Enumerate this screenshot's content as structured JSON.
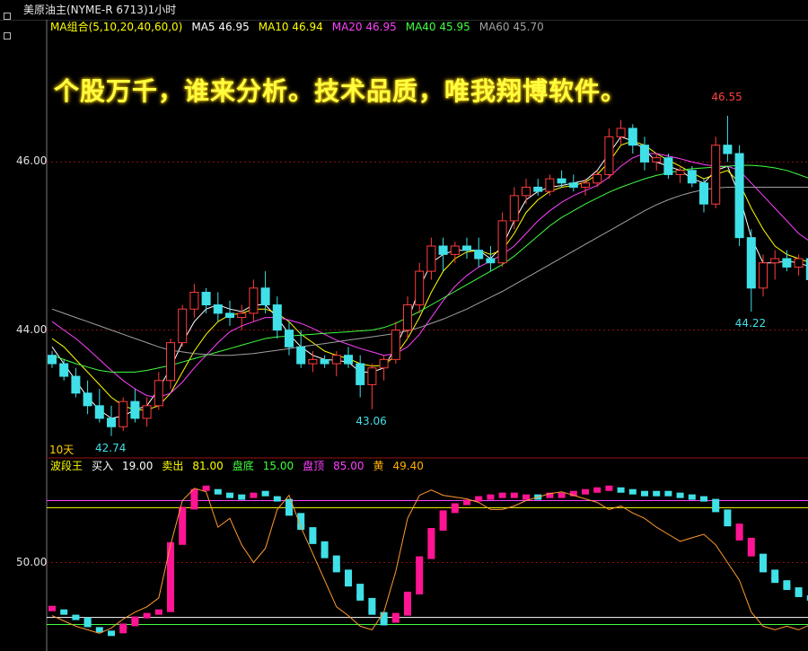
{
  "window": {
    "title": "美原油主(NYME-R 6713)1小时"
  },
  "slogan": "个股万千，谁来分析。技术品质，唯我翔博软件。",
  "period_label": "10天",
  "colors": {
    "up": "#ff3c3c",
    "down": "#40e0e8",
    "ma5": "#ffffff",
    "ma10": "#ffff00",
    "ma20": "#ff40ff",
    "ma40": "#40ff40",
    "ma60": "#a0a0a0",
    "osc_up": "#ff1493",
    "osc_down": "#40e0e8",
    "osc_line": "#ff9a30"
  },
  "ma_legend": [
    {
      "text": "MA组合(5,10,20,40,60,0)",
      "color": "#ffff00"
    },
    {
      "text": "MA5 46.95",
      "color": "#ffffff"
    },
    {
      "text": "MA10 46.94",
      "color": "#ffff00"
    },
    {
      "text": "MA20 46.95",
      "color": "#ff40ff"
    },
    {
      "text": "MA40 45.95",
      "color": "#40ff40"
    },
    {
      "text": "MA60 45.70",
      "color": "#a0a0a0"
    }
  ],
  "osc_legend": [
    {
      "text": "波段王",
      "color": "#ffff00"
    },
    {
      "text": "买入",
      "color": "#ffffff"
    },
    {
      "text": "19.00",
      "color": "#ffffff"
    },
    {
      "text": "卖出",
      "color": "#ffff00"
    },
    {
      "text": "81.00",
      "color": "#ffff00"
    },
    {
      "text": "盘底",
      "color": "#40ff40"
    },
    {
      "text": "15.00",
      "color": "#40ff40"
    },
    {
      "text": "盘顶",
      "color": "#ff40ff"
    },
    {
      "text": "85.00",
      "color": "#ff40ff"
    },
    {
      "text": "黄",
      "color": "#ffb000"
    },
    {
      "text": "49.40",
      "color": "#ffb000"
    }
  ],
  "annotations": [
    {
      "text": "46.55",
      "color": "#ff4040",
      "price": 46.55
    },
    {
      "text": "43.06",
      "color": "#40e0e8",
      "price": 43.06
    },
    {
      "text": "42.74",
      "color": "#40e0e8",
      "price": 42.74
    },
    {
      "text": "44.22",
      "color": "#40e0e8",
      "price": 44.22
    }
  ],
  "chart_data": [
    {
      "type": "candlestick",
      "ylabels": [
        "46.00",
        "44.00"
      ],
      "yticks": [
        46.0,
        44.0
      ],
      "ylim": [
        42.5,
        47.5
      ],
      "series": [
        {
          "name": "candles",
          "values": [
            [
              43.7,
              43.75,
              43.55,
              43.6
            ],
            [
              43.6,
              43.65,
              43.4,
              43.45
            ],
            [
              43.45,
              43.55,
              43.2,
              43.25
            ],
            [
              43.25,
              43.4,
              43.0,
              43.1
            ],
            [
              43.1,
              43.3,
              42.9,
              42.95
            ],
            [
              42.95,
              43.1,
              42.74,
              42.85
            ],
            [
              42.85,
              43.2,
              42.8,
              43.15
            ],
            [
              43.15,
              43.3,
              42.9,
              42.95
            ],
            [
              42.95,
              43.2,
              42.85,
              43.1
            ],
            [
              43.1,
              43.5,
              43.05,
              43.4
            ],
            [
              43.4,
              43.9,
              43.3,
              43.85
            ],
            [
              43.85,
              44.3,
              43.8,
              44.25
            ],
            [
              44.25,
              44.55,
              44.15,
              44.45
            ],
            [
              44.45,
              44.5,
              44.2,
              44.3
            ],
            [
              44.3,
              44.45,
              44.1,
              44.2
            ],
            [
              44.2,
              44.35,
              44.05,
              44.15
            ],
            [
              44.15,
              44.3,
              44.0,
              44.2
            ],
            [
              44.2,
              44.6,
              44.1,
              44.5
            ],
            [
              44.5,
              44.7,
              44.2,
              44.3
            ],
            [
              44.3,
              44.4,
              43.9,
              44.0
            ],
            [
              44.0,
              44.1,
              43.7,
              43.8
            ],
            [
              43.8,
              44.0,
              43.55,
              43.6
            ],
            [
              43.6,
              43.75,
              43.5,
              43.65
            ],
            [
              43.65,
              43.7,
              43.55,
              43.6
            ],
            [
              43.6,
              43.75,
              43.45,
              43.7
            ],
            [
              43.7,
              43.8,
              43.55,
              43.6
            ],
            [
              43.6,
              43.7,
              43.2,
              43.35
            ],
            [
              43.35,
              43.6,
              43.06,
              43.55
            ],
            [
              43.55,
              43.7,
              43.4,
              43.65
            ],
            [
              43.65,
              44.1,
              43.6,
              44.0
            ],
            [
              44.0,
              44.4,
              43.9,
              44.3
            ],
            [
              44.3,
              44.8,
              44.2,
              44.7
            ],
            [
              44.7,
              45.1,
              44.6,
              45.0
            ],
            [
              45.0,
              45.1,
              44.7,
              44.9
            ],
            [
              44.9,
              45.05,
              44.8,
              45.0
            ],
            [
              45.0,
              45.1,
              44.85,
              44.95
            ],
            [
              44.95,
              45.1,
              44.75,
              44.85
            ],
            [
              44.85,
              45.0,
              44.7,
              44.8
            ],
            [
              44.8,
              45.4,
              44.75,
              45.3
            ],
            [
              45.3,
              45.7,
              45.2,
              45.6
            ],
            [
              45.6,
              45.8,
              45.5,
              45.7
            ],
            [
              45.7,
              45.8,
              45.6,
              45.65
            ],
            [
              45.65,
              45.85,
              45.6,
              45.8
            ],
            [
              45.8,
              45.9,
              45.7,
              45.75
            ],
            [
              45.75,
              45.85,
              45.65,
              45.7
            ],
            [
              45.7,
              45.8,
              45.6,
              45.75
            ],
            [
              45.75,
              45.9,
              45.7,
              45.85
            ],
            [
              45.85,
              46.4,
              45.8,
              46.3
            ],
            [
              46.3,
              46.5,
              46.2,
              46.4
            ],
            [
              46.4,
              46.45,
              46.1,
              46.2
            ],
            [
              46.2,
              46.3,
              45.9,
              46.0
            ],
            [
              46.0,
              46.1,
              45.9,
              46.05
            ],
            [
              46.05,
              46.1,
              45.8,
              45.85
            ],
            [
              45.85,
              45.95,
              45.75,
              45.9
            ],
            [
              45.9,
              45.95,
              45.7,
              45.75
            ],
            [
              45.75,
              45.8,
              45.4,
              45.5
            ],
            [
              45.5,
              46.3,
              45.45,
              46.2
            ],
            [
              46.2,
              46.55,
              46.0,
              46.1
            ],
            [
              46.1,
              46.2,
              45.0,
              45.1
            ],
            [
              45.1,
              45.2,
              44.22,
              44.5
            ],
            [
              44.5,
              44.9,
              44.4,
              44.8
            ],
            [
              44.8,
              44.95,
              44.6,
              44.85
            ],
            [
              44.85,
              44.95,
              44.7,
              44.75
            ],
            [
              44.75,
              44.9,
              44.65,
              44.85
            ],
            [
              44.85,
              44.9,
              44.55,
              44.6
            ]
          ]
        },
        {
          "name": "MA5",
          "values": [
            43.8,
            43.6,
            43.4,
            43.2,
            43.05,
            42.95,
            42.98,
            43.05,
            43.1,
            43.3,
            43.55,
            43.85,
            44.1,
            44.25,
            44.3,
            44.25,
            44.22,
            44.3,
            44.3,
            44.15,
            43.95,
            43.8,
            43.7,
            43.65,
            43.64,
            43.62,
            43.5,
            43.5,
            43.55,
            43.8,
            44.1,
            44.5,
            44.8,
            44.9,
            44.95,
            44.95,
            44.95,
            44.85,
            45.0,
            45.3,
            45.55,
            45.65,
            45.7,
            45.72,
            45.75,
            45.78,
            45.9,
            46.1,
            46.3,
            46.25,
            46.15,
            46.0,
            45.95,
            45.9,
            45.8,
            45.75,
            45.9,
            45.95,
            45.6,
            45.1,
            44.8,
            44.8,
            44.82,
            44.8,
            44.75
          ]
        },
        {
          "name": "MA10",
          "values": [
            43.9,
            43.8,
            43.65,
            43.5,
            43.35,
            43.2,
            43.1,
            43.05,
            43.05,
            43.1,
            43.25,
            43.5,
            43.75,
            43.95,
            44.1,
            44.18,
            44.2,
            44.25,
            44.25,
            44.2,
            44.1,
            43.95,
            43.85,
            43.75,
            43.7,
            43.66,
            43.6,
            43.57,
            43.58,
            43.7,
            43.9,
            44.15,
            44.45,
            44.7,
            44.85,
            44.93,
            44.95,
            44.9,
            44.95,
            45.15,
            45.4,
            45.55,
            45.65,
            45.7,
            45.72,
            45.76,
            45.85,
            46.0,
            46.2,
            46.25,
            46.2,
            46.1,
            46.02,
            45.95,
            45.87,
            45.8,
            45.85,
            45.9,
            45.75,
            45.45,
            45.2,
            45.0,
            44.9,
            44.85,
            44.8
          ]
        },
        {
          "name": "MA20",
          "values": [
            44.1,
            44.0,
            43.9,
            43.78,
            43.65,
            43.52,
            43.4,
            43.3,
            43.22,
            43.2,
            43.25,
            43.38,
            43.55,
            43.7,
            43.85,
            43.98,
            44.05,
            44.1,
            44.15,
            44.15,
            44.12,
            44.08,
            44.02,
            43.95,
            43.88,
            43.83,
            43.78,
            43.74,
            43.7,
            43.72,
            43.8,
            43.95,
            44.15,
            44.35,
            44.52,
            44.65,
            44.75,
            44.82,
            44.9,
            45.0,
            45.15,
            45.3,
            45.42,
            45.52,
            45.6,
            45.66,
            45.72,
            45.82,
            45.95,
            46.05,
            46.1,
            46.1,
            46.07,
            46.04,
            46.0,
            45.97,
            45.95,
            45.95,
            45.9,
            45.75,
            45.6,
            45.45,
            45.3,
            45.15,
            45.05
          ]
        },
        {
          "name": "MA40",
          "values": [
            43.7,
            43.65,
            43.6,
            43.56,
            43.52,
            43.5,
            43.5,
            43.5,
            43.52,
            43.55,
            43.58,
            43.62,
            43.66,
            43.7,
            43.74,
            43.78,
            43.82,
            43.86,
            43.9,
            43.92,
            43.93,
            43.94,
            43.95,
            43.96,
            43.97,
            43.98,
            43.99,
            44.0,
            44.03,
            44.08,
            44.15,
            44.22,
            44.3,
            44.38,
            44.46,
            44.54,
            44.62,
            44.7,
            44.78,
            44.88,
            45.0,
            45.12,
            45.24,
            45.34,
            45.42,
            45.5,
            45.57,
            45.64,
            45.7,
            45.75,
            45.8,
            45.84,
            45.87,
            45.9,
            45.92,
            45.93,
            45.94,
            45.95,
            45.96,
            45.96,
            45.95,
            45.93,
            45.9,
            45.85,
            45.8
          ]
        },
        {
          "name": "MA60",
          "values": [
            44.25,
            44.2,
            44.15,
            44.1,
            44.05,
            44.0,
            43.95,
            43.9,
            43.85,
            43.8,
            43.76,
            43.74,
            43.72,
            43.71,
            43.7,
            43.7,
            43.71,
            43.72,
            43.74,
            43.76,
            43.78,
            43.8,
            43.82,
            43.84,
            43.86,
            43.88,
            43.9,
            43.92,
            43.94,
            43.96,
            43.99,
            44.03,
            44.08,
            44.13,
            44.19,
            44.25,
            44.32,
            44.39,
            44.46,
            44.54,
            44.62,
            44.7,
            44.78,
            44.86,
            44.94,
            45.02,
            45.1,
            45.18,
            45.26,
            45.34,
            45.42,
            45.49,
            45.55,
            45.6,
            45.64,
            45.67,
            45.69,
            45.7,
            45.7,
            45.7,
            45.7,
            45.7,
            45.7,
            45.7,
            45.7
          ]
        }
      ]
    },
    {
      "type": "bar",
      "ylabels": [
        "50.00"
      ],
      "yticks": [
        50
      ],
      "ylim": [
        0,
        100
      ],
      "hlines": [
        85,
        81,
        19,
        15
      ],
      "series": [
        {
          "name": "bands",
          "values": [
            24,
            22,
            19,
            15,
            12,
            10,
            14,
            18,
            20,
            22,
            60,
            80,
            90,
            92,
            90,
            88,
            87,
            88,
            89,
            86,
            78,
            70,
            62,
            54,
            46,
            38,
            30,
            22,
            16,
            20,
            32,
            52,
            68,
            78,
            82,
            84,
            86,
            87,
            88,
            88,
            87,
            87,
            88,
            88,
            89,
            90,
            91,
            92,
            91,
            90,
            89,
            89,
            89,
            88,
            87,
            86,
            80,
            72,
            64,
            55,
            46,
            40,
            36,
            32,
            30
          ],
          "up": [
            1,
            0,
            0,
            0,
            0,
            0,
            1,
            1,
            1,
            1,
            1,
            1,
            1,
            1,
            0,
            0,
            0,
            1,
            0,
            0,
            0,
            0,
            0,
            0,
            0,
            0,
            0,
            0,
            0,
            1,
            1,
            1,
            1,
            1,
            1,
            1,
            1,
            1,
            1,
            1,
            1,
            0,
            1,
            1,
            1,
            1,
            1,
            1,
            0,
            0,
            0,
            0,
            0,
            0,
            0,
            0,
            0,
            0,
            1,
            1,
            0,
            0,
            0,
            0,
            0
          ]
        },
        {
          "name": "osc",
          "values": [
            20,
            17,
            14,
            12,
            10,
            13,
            18,
            22,
            25,
            30,
            60,
            85,
            92,
            90,
            70,
            75,
            60,
            50,
            58,
            80,
            88,
            70,
            55,
            40,
            25,
            20,
            14,
            12,
            22,
            45,
            75,
            88,
            91,
            88,
            87,
            86,
            84,
            80,
            80,
            82,
            85,
            87,
            89,
            90,
            88,
            86,
            84,
            80,
            82,
            78,
            75,
            70,
            66,
            62,
            64,
            66,
            60,
            50,
            40,
            22,
            14,
            12,
            14,
            12,
            15
          ]
        }
      ]
    }
  ]
}
